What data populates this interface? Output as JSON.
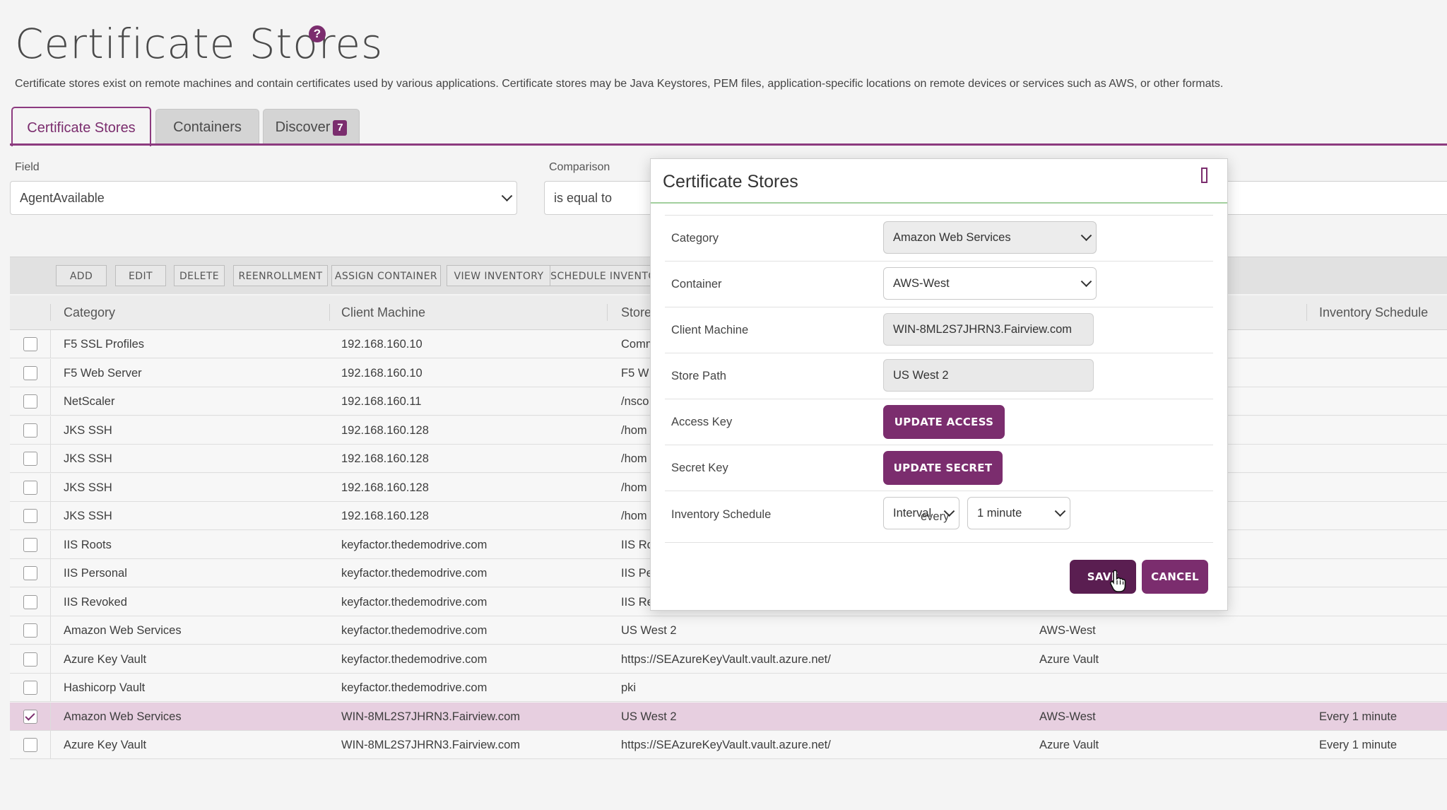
{
  "page": {
    "title": "Certificate Stores",
    "description": "Certificate stores exist on remote machines and contain certificates used by various applications. Certificate stores may be Java Keystores, PEM files, application-specific locations on remote devices or services such as AWS, or other formats."
  },
  "tabs": [
    {
      "label": "Certificate Stores",
      "active": true
    },
    {
      "label": "Containers",
      "active": false
    },
    {
      "label": "Discover",
      "badge": "7",
      "active": false
    }
  ],
  "filter": {
    "field_label": "Field",
    "field_value": "AgentAvailable",
    "comparison_label": "Comparison",
    "comparison_value": "is equal to"
  },
  "toolbar": {
    "buttons": [
      "ADD",
      "EDIT",
      "DELETE",
      "REENROLLMENT",
      "ASSIGN CONTAINER",
      "VIEW INVENTORY",
      "SCHEDULE INVENTO"
    ]
  },
  "table": {
    "headers": {
      "category": "Category",
      "client_machine": "Client Machine",
      "store": "Store",
      "inventory_schedule": "Inventory Schedule"
    },
    "rows": [
      {
        "checked": false,
        "category": "F5 SSL Profiles",
        "client": "192.168.160.10",
        "store": "Comm",
        "container": "",
        "schedule": ""
      },
      {
        "checked": false,
        "category": "F5 Web Server",
        "client": "192.168.160.10",
        "store": "F5 W",
        "container": "",
        "schedule": ""
      },
      {
        "checked": false,
        "category": "NetScaler",
        "client": "192.168.160.11",
        "store": "/nsco",
        "container": "",
        "schedule": ""
      },
      {
        "checked": false,
        "category": "JKS SSH",
        "client": "192.168.160.128",
        "store": "/hom",
        "container": "",
        "schedule": ""
      },
      {
        "checked": false,
        "category": "JKS SSH",
        "client": "192.168.160.128",
        "store": "/hom",
        "container": "",
        "schedule": ""
      },
      {
        "checked": false,
        "category": "JKS SSH",
        "client": "192.168.160.128",
        "store": "/hom",
        "container": "",
        "schedule": ""
      },
      {
        "checked": false,
        "category": "JKS SSH",
        "client": "192.168.160.128",
        "store": "/hom",
        "container": "",
        "schedule": ""
      },
      {
        "checked": false,
        "category": "IIS Roots",
        "client": "keyfactor.thedemodrive.com",
        "store": "IIS Ro",
        "container": "",
        "schedule": ""
      },
      {
        "checked": false,
        "category": "IIS Personal",
        "client": "keyfactor.thedemodrive.com",
        "store": "IIS Pe",
        "container": "",
        "schedule": ""
      },
      {
        "checked": false,
        "category": "IIS Revoked",
        "client": "keyfactor.thedemodrive.com",
        "store": "IIS Re",
        "container": "",
        "schedule": ""
      },
      {
        "checked": false,
        "category": "Amazon Web Services",
        "client": "keyfactor.thedemodrive.com",
        "store": "US West 2",
        "container": "AWS-West",
        "schedule": ""
      },
      {
        "checked": false,
        "category": "Azure Key Vault",
        "client": "keyfactor.thedemodrive.com",
        "store": "https://SEAzureKeyVault.vault.azure.net/",
        "container": "Azure Vault",
        "schedule": ""
      },
      {
        "checked": false,
        "category": "Hashicorp Vault",
        "client": "keyfactor.thedemodrive.com",
        "store": "pki",
        "container": "",
        "schedule": ""
      },
      {
        "checked": true,
        "category": "Amazon Web Services",
        "client": "WIN-8ML2S7JHRN3.Fairview.com",
        "store": "US West 2",
        "container": "AWS-West",
        "schedule": "Every 1 minute"
      },
      {
        "checked": false,
        "category": "Azure Key Vault",
        "client": "WIN-8ML2S7JHRN3.Fairview.com",
        "store": "https://SEAzureKeyVault.vault.azure.net/",
        "container": "Azure Vault",
        "schedule": "Every 1 minute"
      }
    ]
  },
  "modal": {
    "title": "Certificate Stores",
    "category_label": "Category",
    "category_value": "Amazon Web Services",
    "container_label": "Container",
    "container_value": "AWS-West",
    "client_label": "Client Machine",
    "client_value": "WIN-8ML2S7JHRN3.Fairview.com",
    "store_path_label": "Store Path",
    "store_path_value": "US West 2",
    "access_key_label": "Access Key",
    "access_key_button": "UPDATE ACCESS KEY",
    "secret_key_label": "Secret Key",
    "secret_key_button": "UPDATE SECRET KEY",
    "schedule_label": "Inventory Schedule",
    "schedule_type": "Interval",
    "every_text": "every",
    "schedule_interval": "1 minute",
    "save_label": "SAVE",
    "cancel_label": "CANCEL"
  },
  "colors": {
    "accent": "#7b2d6e",
    "selected_row": "#e7cfe0",
    "modal_rule": "#a2cf9e"
  }
}
